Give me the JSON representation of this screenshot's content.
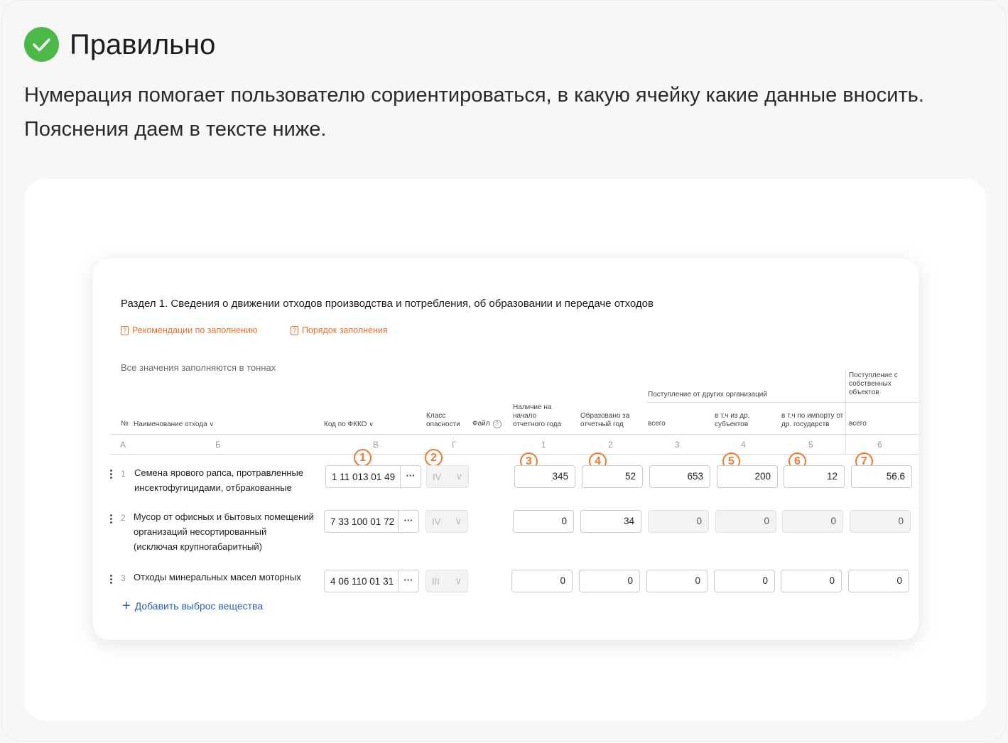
{
  "status": {
    "icon": "check-circle-icon",
    "color": "#4cb848",
    "title": "Правильно"
  },
  "description": "Нумерация помогает пользователю сориентироваться, в какую ячейку какие данные вносить. Пояснения даем в тексте ниже.",
  "form": {
    "section_title": "Раздел 1. Сведения о движении отходов производства и потребления, об образовании и передаче отходов",
    "links": [
      "Рекомендации по заполнению",
      "Порядок заполнения"
    ],
    "units_note": "Все значения заполняются в тоннах",
    "group_headers": {
      "incoming_other": "Поступление от других организаций",
      "incoming_own": "Поступление с собственных объектов"
    },
    "headers": {
      "no": "№",
      "name": "Наименование отхода",
      "code": "Код по ФККО",
      "hazard": "Класс опасности",
      "file": "Файл",
      "start": "Наличие на начало отчетного года",
      "formed": "Образовано за отчетный год",
      "total": "всего",
      "subjects": "в т.ч из др. субъектов",
      "import": "в т.ч по импорту от др. государств",
      "own_total": "всего"
    },
    "col_index": [
      "А",
      "Б",
      "В",
      "Г",
      "1",
      "2",
      "3",
      "4",
      "5",
      "6"
    ],
    "markers": [
      "1",
      "2",
      "3",
      "4",
      "5",
      "6",
      "7"
    ],
    "accent_color": "#ee7a32",
    "rows": [
      {
        "num": "1",
        "name_lines": [
          "Семена ярового рапса, протравленные",
          "инсектофугицидами, отбракованные"
        ],
        "code": "1 11 013 01 49",
        "hazard": "IV",
        "values": [
          "345",
          "52",
          "653",
          "200",
          "12",
          "56.6"
        ]
      },
      {
        "num": "2",
        "name_lines": [
          "Мусор от офисных и бытовых помещений",
          "организаций несортированный",
          "(исключая крупногабаритный)"
        ],
        "code": "7 33 100 01 72",
        "hazard": "IV",
        "values": [
          "0",
          "34",
          "0",
          "0",
          "0",
          "0"
        ]
      },
      {
        "num": "3",
        "name_lines": [
          "Отходы минеральных масел моторных"
        ],
        "code": "4 06 110 01 31",
        "hazard": "III",
        "values": [
          "0",
          "0",
          "0",
          "0",
          "0",
          "0"
        ]
      }
    ],
    "add_label": "Добавить выброс вещества"
  }
}
